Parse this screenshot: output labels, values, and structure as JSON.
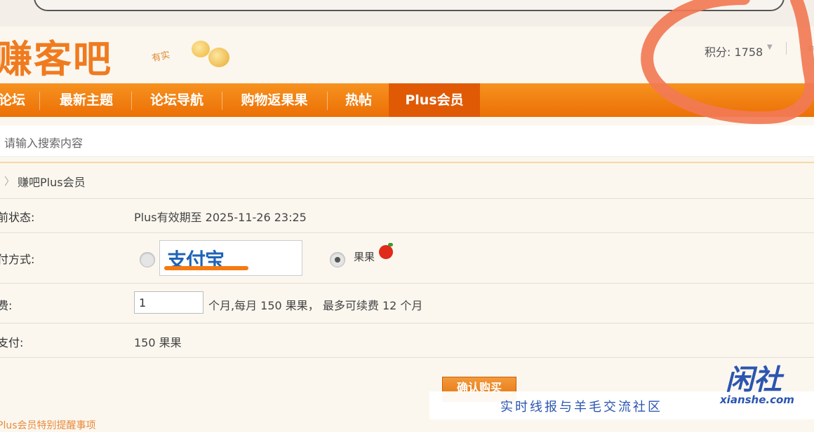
{
  "header": {
    "logo_text": "赚客吧",
    "logo_small": "有实",
    "score_label": "积分: 1758",
    "score_caret": "▼",
    "score_tail": "≡"
  },
  "nav": {
    "items": [
      {
        "label": "论坛"
      },
      {
        "label": "最新主题"
      },
      {
        "label": "论坛导航"
      },
      {
        "label": "购物返果果"
      },
      {
        "label": "热帖"
      },
      {
        "label": "Plus会员"
      }
    ]
  },
  "search": {
    "placeholder": "请输入搜索内容"
  },
  "breadcrumb": {
    "chevron": "〉",
    "current": "赚吧Plus会员"
  },
  "form": {
    "status_label": "前状态:",
    "status_value": "Plus有效期至 2025-11-26 23:25",
    "payment_label": "付方式:",
    "payment_options": [
      {
        "name": "支付宝",
        "selected": false
      },
      {
        "name": "果果",
        "selected": true
      }
    ],
    "renew_label": "费:",
    "renew_months_value": "1",
    "renew_note": "个月,每月 150 果果， 最多可续费 12 个月",
    "pay_label": "支付:",
    "pay_value": "150 果果",
    "confirm_button": "确认购买"
  },
  "footer_peek": "Plus会员特别提醒事项",
  "watermark": {
    "logo": "闲社",
    "domain": "xianshe.com",
    "slogan": "实时线报与羊毛交流社区"
  },
  "colors": {
    "brand_orange": "#ec6f05",
    "annotation_coral": "#f27a55",
    "watermark_blue": "#2b55b0"
  }
}
